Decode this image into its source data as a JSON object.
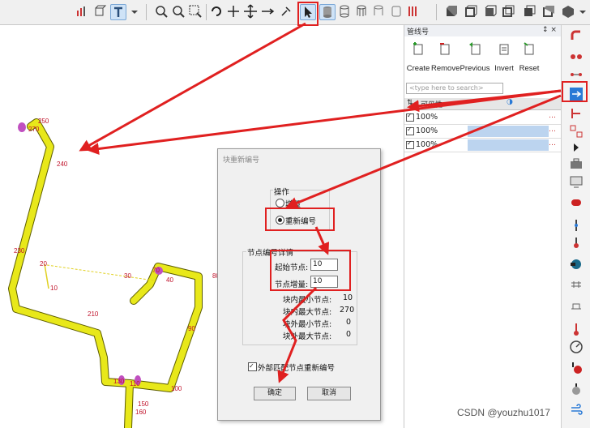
{
  "panel": {
    "title": "管线号",
    "pin": "↕ ×",
    "controls": [
      {
        "label": "Create",
        "icon": "create-icon"
      },
      {
        "label": "Remove",
        "icon": "remove-icon"
      },
      {
        "label": "Previous",
        "icon": "previous-icon"
      },
      {
        "label": "Invert",
        "icon": "invert-icon"
      },
      {
        "label": "Reset",
        "icon": "reset-icon"
      }
    ],
    "search_placeholder": "<type here to search>",
    "grid_header": "可见性",
    "rows": [
      {
        "value": "100%"
      },
      {
        "value": "100%"
      },
      {
        "value": "100%"
      }
    ]
  },
  "viewport": {
    "labels": [
      "250",
      "270",
      "240",
      "230",
      "20",
      "10",
      "30",
      "70",
      "40",
      "80",
      "210",
      "90",
      "130",
      "110",
      "100",
      "150",
      "160"
    ]
  },
  "dialog": {
    "title": "块重新编号",
    "operation_label": "操作",
    "option_increment": "增量",
    "option_renumber": "重新编号",
    "detail_label": "节点编号详情",
    "start_node_label": "起始节点:",
    "start_node_value": "10",
    "increment_label": "节点增量:",
    "increment_value": "10",
    "stats": [
      {
        "label": "块内最小节点:",
        "value": "10"
      },
      {
        "label": "块内最大节点:",
        "value": "270"
      },
      {
        "label": "块外最小节点:",
        "value": "0"
      },
      {
        "label": "块外最大节点:",
        "value": "0"
      }
    ],
    "external_label": "外部匹配节点重新编号",
    "ok_label": "确定",
    "cancel_label": "取消"
  },
  "watermark": "CSDN @youzhu1017",
  "colors": {
    "pipe": "#e8e81a",
    "annotation_red": "#e02020",
    "label_red": "#c0122a",
    "accent_blue": "#2a7ad6"
  }
}
